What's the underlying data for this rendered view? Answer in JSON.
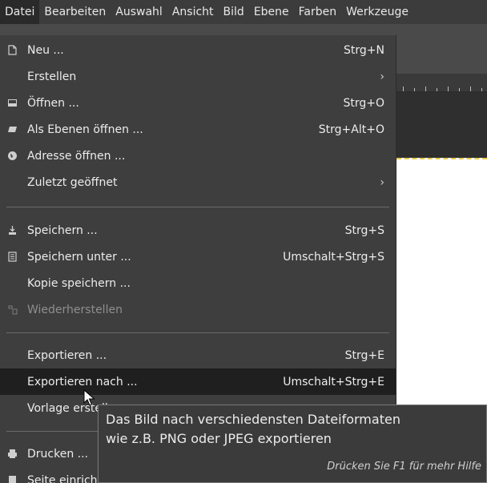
{
  "menubar": {
    "items": [
      "Datei",
      "Bearbeiten",
      "Auswahl",
      "Ansicht",
      "Bild",
      "Ebene",
      "Farben",
      "Werkzeuge"
    ]
  },
  "menu": {
    "items": [
      {
        "label": "Neu ...",
        "accel": "Strg+N",
        "icon": "new-file-icon"
      },
      {
        "label": "Erstellen",
        "submenu": true
      },
      {
        "label": "Öffnen ...",
        "accel": "Strg+O",
        "icon": "open-icon"
      },
      {
        "label": "Als Ebenen öffnen ...",
        "accel": "Strg+Alt+O",
        "icon": "open-as-layers-icon"
      },
      {
        "label": "Adresse öffnen ...",
        "icon": "globe-icon"
      },
      {
        "label": "Zuletzt geöffnet",
        "submenu": true
      },
      {
        "label": "Speichern ...",
        "accel": "Strg+S",
        "icon": "save-icon"
      },
      {
        "label": "Speichern unter ...",
        "accel": "Umschalt+Strg+S",
        "icon": "save-as-icon"
      },
      {
        "label": "Kopie speichern ..."
      },
      {
        "label": "Wiederherstellen",
        "icon": "revert-icon",
        "disabled": true
      },
      {
        "label": "Exportieren ...",
        "accel": "Strg+E"
      },
      {
        "label": "Exportieren nach ...",
        "accel": "Umschalt+Strg+E",
        "highlighted": true
      },
      {
        "label": "Vorlage erstellen ..."
      },
      {
        "label": "Drucken ...",
        "icon": "print-icon"
      },
      {
        "label": "Seite einrichten ...",
        "icon": "page-setup-icon"
      }
    ]
  },
  "tooltip": {
    "line1": "Das Bild nach verschiedensten Dateiformaten",
    "line2": "wie z.B. PNG oder JPEG exportieren",
    "hint": "Drücken Sie F1 für mehr Hilfe"
  }
}
